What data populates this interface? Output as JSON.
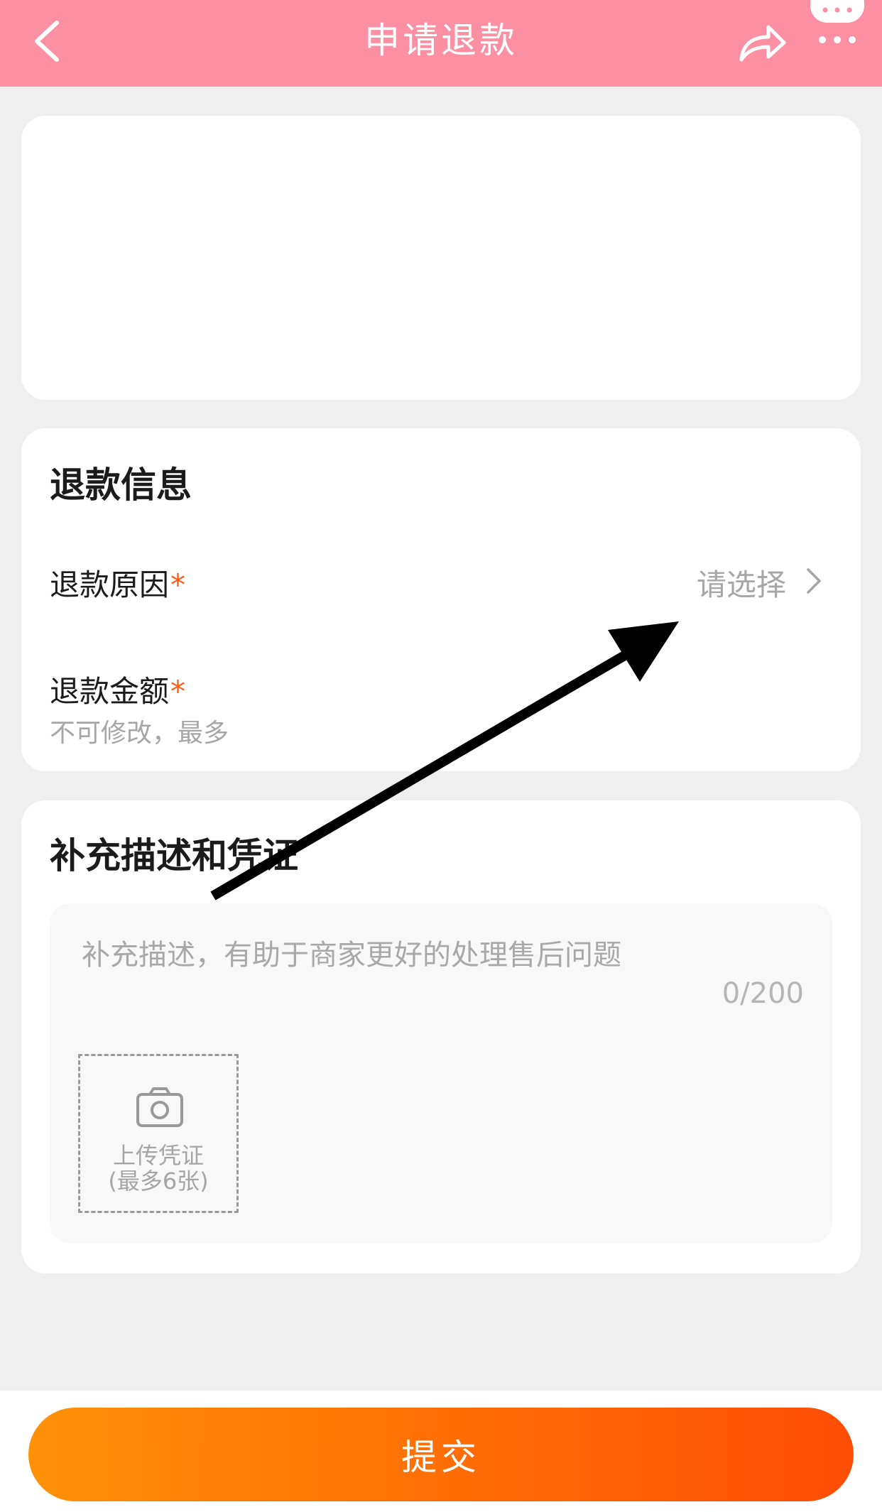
{
  "nav": {
    "title": "申请退款",
    "icons": {
      "back": "chevron-left-icon",
      "share": "share-arrow-icon",
      "more": "more-dots-icon"
    }
  },
  "refund_info": {
    "title": "退款信息",
    "reason_label": "退款原因",
    "reason_required": "*",
    "reason_value": "请选择",
    "amount_label": "退款金额",
    "amount_required": "*",
    "amount_hint": "不可修改，最多"
  },
  "description": {
    "title": "补充描述和凭证",
    "placeholder": "补充描述，有助于商家更好的处理售后问题",
    "counter": "0/200",
    "upload_line1": "上传凭证",
    "upload_line2": "(最多6张)"
  },
  "submit_label": "提交",
  "colors": {
    "navbar": "#fd8fa3",
    "required": "#ff5a17",
    "submit_gradient_start": "#ff9107",
    "submit_gradient_end": "#ff4d06"
  }
}
